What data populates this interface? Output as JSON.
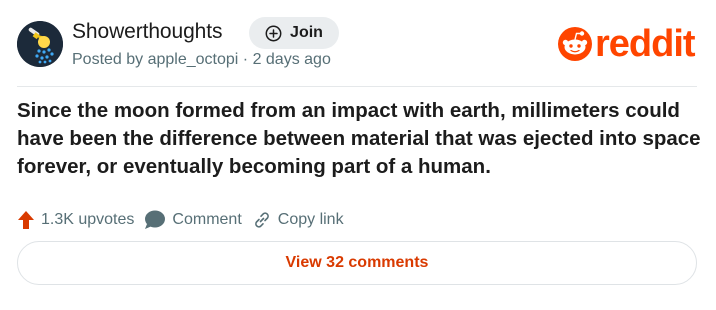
{
  "subreddit": {
    "name": "Showerthoughts",
    "avatar_icon": "lightbulb-shower-icon",
    "join_label": "Join",
    "join_icon": "plus-circle-icon"
  },
  "post": {
    "meta": "Posted by apple_octopi · 2 days ago",
    "title": "Since the moon formed from an impact with earth, millimeters could have been the difference between material that was ejected into space forever, or eventually becoming part of a human."
  },
  "brand": {
    "logo_text": "reddit",
    "logo_icon": "snoo-icon",
    "color": "#ff4500"
  },
  "actions": {
    "upvotes": "1.3K upvotes",
    "upvote_icon": "upvote-arrow-icon",
    "comment_label": "Comment",
    "comment_icon": "speech-bubble-icon",
    "copy_link_label": "Copy link",
    "copy_link_icon": "link-icon"
  },
  "view_comments": {
    "label": "View 32 comments",
    "color": "#d93a00"
  }
}
